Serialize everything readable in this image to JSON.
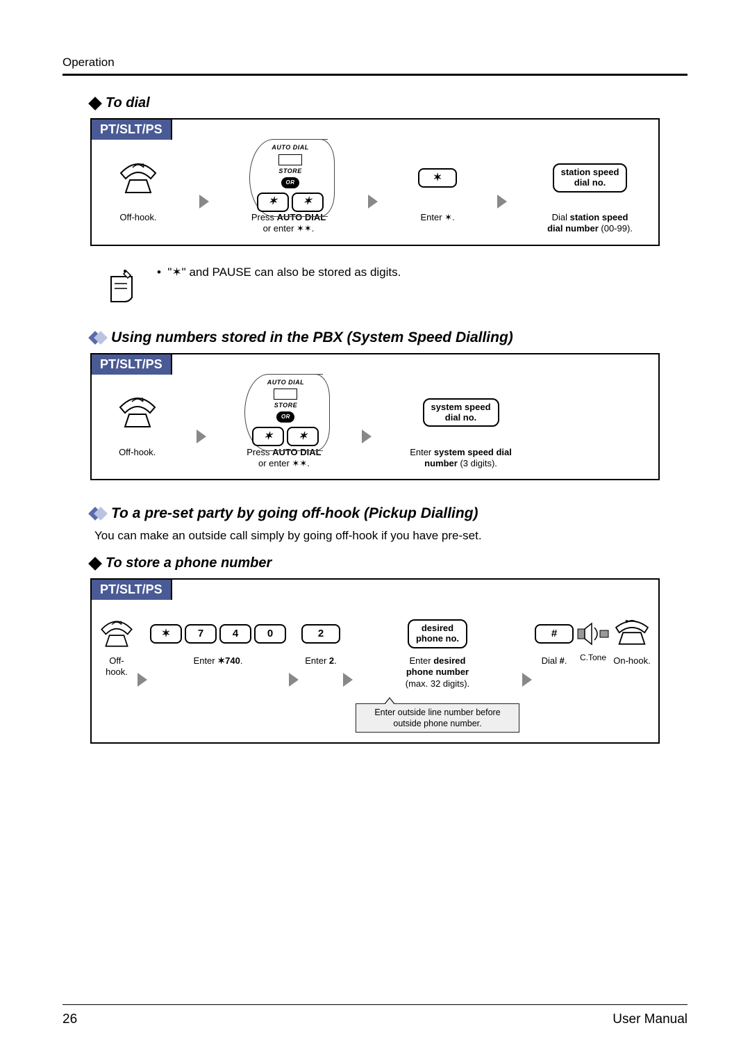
{
  "header": {
    "section": "Operation"
  },
  "headings": {
    "to_dial": "To dial",
    "system_speed": "Using numbers stored in the PBX (System Speed Dialling)",
    "pickup": "To a pre-set party by going off-hook (Pickup Dialling)",
    "store": "To store a phone number"
  },
  "tab_label": "PT/SLT/PS",
  "autodial": {
    "top": "AUTO DIAL",
    "bottom": "STORE",
    "or": "OR"
  },
  "diagram1": {
    "offhook": "Off-hook.",
    "press_auto_pre": "Press ",
    "press_auto_b": "AUTO DIAL",
    "press_auto_post": "\nor enter ✶✶.",
    "enter_star": "Enter ✶.",
    "box": "station speed\ndial no.",
    "dial_pre": "Dial ",
    "dial_b": "station speed\ndial number",
    "dial_post": " (00-99)."
  },
  "note1": "\"✶\" and PAUSE can also be stored as digits.",
  "diagram2": {
    "offhook": "Off-hook.",
    "press_auto_pre": "Press ",
    "press_auto_b": "AUTO DIAL",
    "press_auto_post": "\nor enter ✶✶.",
    "box": "system speed\ndial no.",
    "enter_pre": "Enter ",
    "enter_b": "system speed dial\nnumber",
    "enter_post": " (3 digits)."
  },
  "pickup_para": "You can make an outside call simply by going off-hook if you have pre-set.",
  "diagram3": {
    "offhook": "Off-hook.",
    "enter740_pre": "Enter ",
    "enter740_b": "✶740",
    "enter740_post": ".",
    "enter2_pre": "Enter ",
    "enter2_b": "2",
    "enter2_post": ".",
    "box": "desired\nphone no.",
    "enterdesired_pre": "Enter ",
    "enterdesired_b": "desired\nphone number",
    "enterdesired_post": "\n(max. 32 digits).",
    "dialhash_pre": "Dial ",
    "dialhash_b": "#",
    "dialhash_post": ".",
    "ctone": "C.Tone",
    "onhook": "On-hook.",
    "callout": "Enter outside line number before outside phone number.",
    "keys": {
      "star": "✶",
      "k7": "7",
      "k4": "4",
      "k0": "0",
      "k2": "2",
      "hash": "#"
    }
  },
  "footer": {
    "page": "26",
    "manual": "User Manual"
  }
}
